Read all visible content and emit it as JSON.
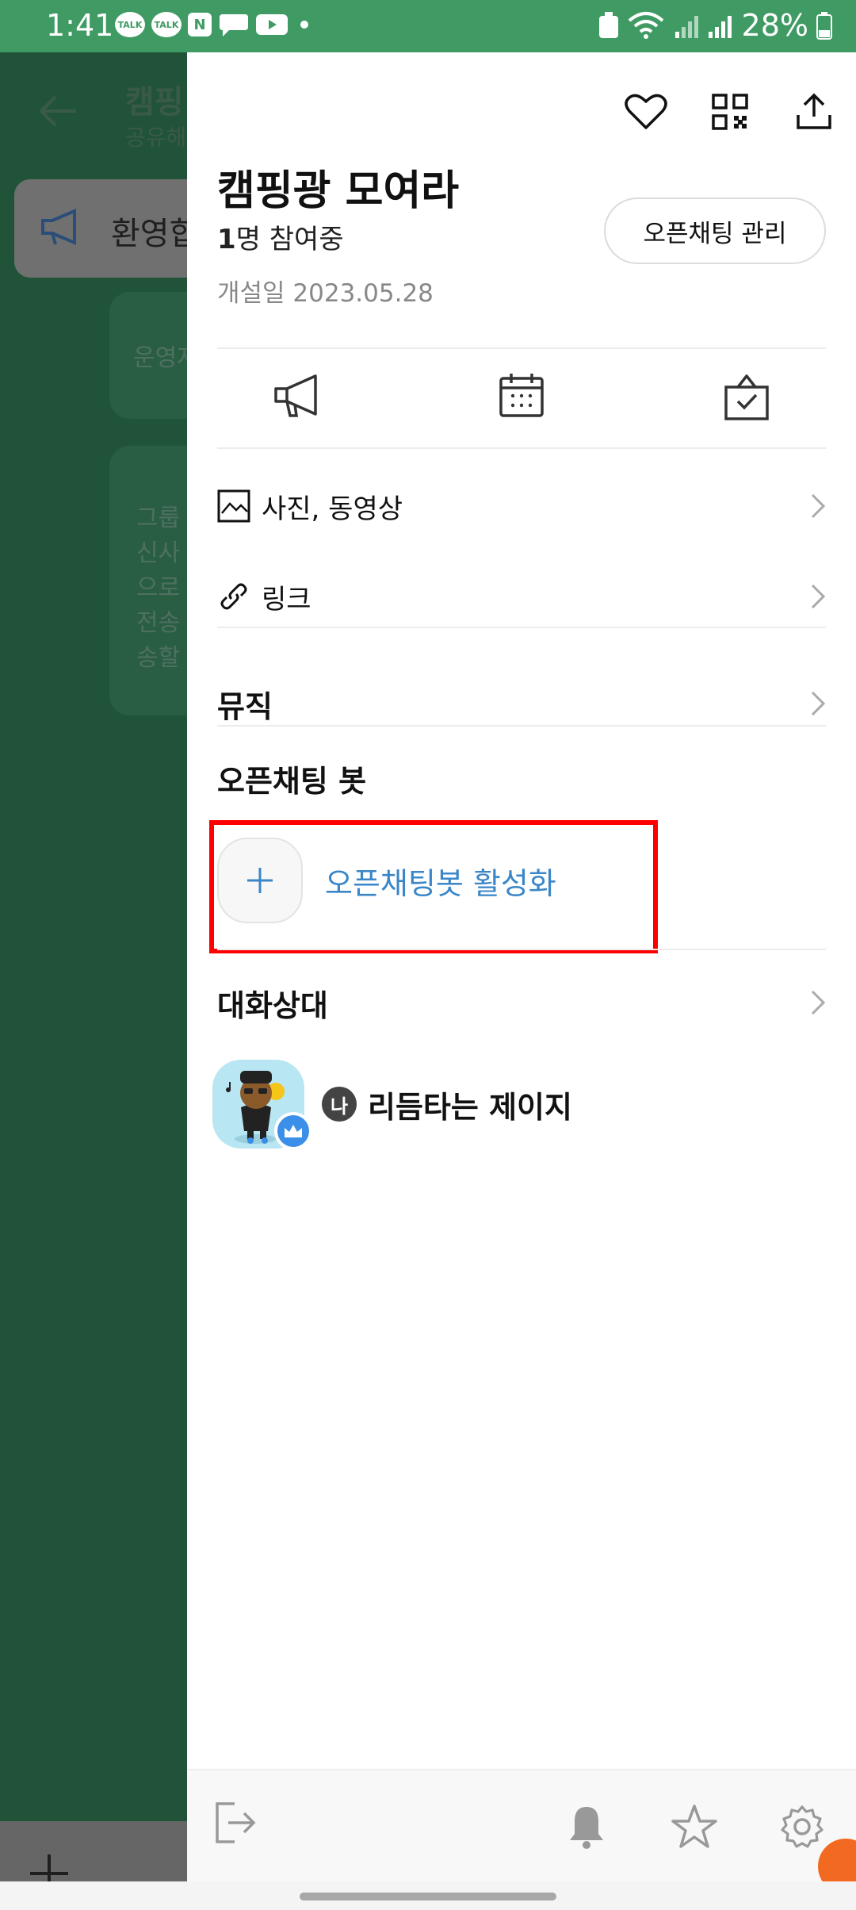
{
  "status_bar": {
    "time": "1:41",
    "battery": "28%",
    "notif_talk": "TALK",
    "notif_n": "N",
    "accent": "#3f9b63"
  },
  "background_chat": {
    "title": "캠핑",
    "subtitle": "공유해",
    "notice_text": "환영합",
    "bubble1": "운영자",
    "bubble2": "그룹\n신사\n으로\n전송\n송할"
  },
  "drawer": {
    "room_title": "캠핑광 모여라",
    "member_count": "1",
    "member_suffix": "명 참여중",
    "created_date": "개설일 2023.05.28",
    "manage_button": "오픈채팅 관리",
    "menu": {
      "photos_label": "사진, 동영상",
      "links_label": "링크",
      "music_label": "뮤직"
    },
    "bot_section_title": "오픈채팅 봇",
    "bot_activate_label": "오픈채팅봇 활성화",
    "participants_title": "대화상대",
    "me_badge": "나",
    "participant_name": "리듬타는 제이지",
    "colors": {
      "link_blue": "#3a86c8",
      "highlight_red": "#ff0000"
    }
  }
}
